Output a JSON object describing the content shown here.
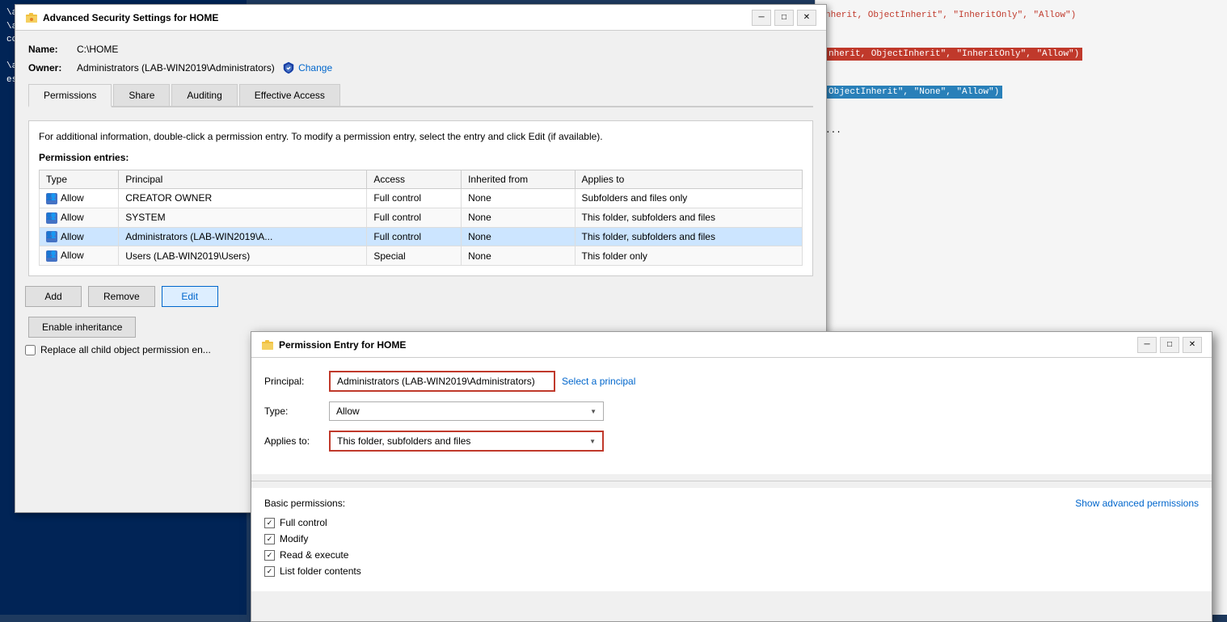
{
  "terminal": {
    "lines": [
      {
        "text": "\\administrator.LAB> $acl | Set-Ac",
        "style": "white"
      },
      {
        "text": "\\administrator.LAB> $AccessRule =",
        "style": "white"
      },
      {
        "text": "ccessRule($AccessRule)",
        "style": "white"
      },
      {
        "text": "",
        "style": "white"
      },
      {
        "text": "\\administrator.LAB> $AccessRule =",
        "style": "white"
      },
      {
        "text": "essRule($AccessRule)",
        "style": "white"
      }
    ]
  },
  "code_panel": {
    "lines": [
      {
        "text": "nherit, ObjectInherit\", \"InheritOnly\", \"Allow\")",
        "style": "red"
      },
      {
        "text": "",
        "style": "normal"
      },
      {
        "text": "nherit, ObjectInherit\", \"InheritOnly\", \"Allow\")",
        "style": "highlight-red"
      },
      {
        "text": "",
        "style": "normal"
      },
      {
        "text": "ObjectInherit\", \"None\", \"Allow\")",
        "style": "highlight-blue"
      },
      {
        "text": "",
        "style": "normal"
      },
      {
        "text": "...",
        "style": "normal"
      }
    ]
  },
  "main_dialog": {
    "title": "Advanced Security Settings for HOME",
    "name_label": "Name:",
    "name_value": "C:\\HOME",
    "owner_label": "Owner:",
    "owner_value": "Administrators (LAB-WIN2019\\Administrators)",
    "change_link": "Change",
    "tabs": [
      {
        "label": "Permissions",
        "active": true
      },
      {
        "label": "Share",
        "active": false
      },
      {
        "label": "Auditing",
        "active": false
      },
      {
        "label": "Effective Access",
        "active": false
      }
    ],
    "info_text": "For additional information, double-click a permission entry. To modify a permission entry, select the entry and click Edit (if available).",
    "permission_entries_label": "Permission entries:",
    "table_headers": [
      "Type",
      "Principal",
      "Access",
      "Inherited from",
      "Applies to"
    ],
    "table_rows": [
      {
        "type": "Allow",
        "principal": "CREATOR OWNER",
        "access": "Full control",
        "inherited_from": "None",
        "applies_to": "Subfolders and files only"
      },
      {
        "type": "Allow",
        "principal": "SYSTEM",
        "access": "Full control",
        "inherited_from": "None",
        "applies_to": "This folder, subfolders and files"
      },
      {
        "type": "Allow",
        "principal": "Administrators (LAB-WIN2019\\A...",
        "access": "Full control",
        "inherited_from": "None",
        "applies_to": "This folder, subfolders and files"
      },
      {
        "type": "Allow",
        "principal": "Users (LAB-WIN2019\\Users)",
        "access": "Special",
        "inherited_from": "None",
        "applies_to": "This folder only"
      }
    ],
    "buttons": {
      "add": "Add",
      "remove": "Remove",
      "edit": "Edit"
    },
    "enable_inheritance": "Enable inheritance",
    "replace_checkbox_label": "Replace all child object permission en..."
  },
  "perm_entry_dialog": {
    "title": "Permission Entry for HOME",
    "principal_label": "Principal:",
    "principal_value": "Administrators (LAB-WIN2019\\Administrators)",
    "select_principal_link": "Select a principal",
    "type_label": "Type:",
    "type_value": "Allow",
    "applies_to_label": "Applies to:",
    "applies_to_value": "This folder, subfolders and files",
    "basic_permissions_label": "Basic permissions:",
    "show_advanced_link": "Show advanced permissions",
    "permissions": [
      {
        "label": "Full control",
        "checked": true
      },
      {
        "label": "Modify",
        "checked": true
      },
      {
        "label": "Read & execute",
        "checked": true
      },
      {
        "label": "List folder contents",
        "checked": true
      }
    ],
    "minimize_label": "─",
    "maximize_label": "□",
    "close_label": "✕"
  }
}
